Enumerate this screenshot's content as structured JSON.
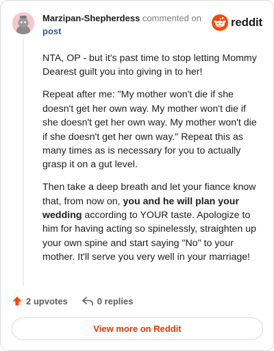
{
  "comment": {
    "author": "Marzipan-Shepherdess",
    "action_text": "commented on",
    "post_link": "post"
  },
  "brand": {
    "name": "reddit",
    "icon": "reddit-logo-icon",
    "color": "#ff4500"
  },
  "body": {
    "p1": "NTA, OP - but it's past time to stop letting Mommy Dearest guilt you into giving in to her!",
    "p2": "Repeat after me: \"My mother won't die if she doesn't get her own way. My mother won't die if she doesn't get her own way. My mother won't die if she doesn't get her own way.\" Repeat this as many times as is necessary for you to actually grasp it on a gut level.",
    "p3_before": "Then take a deep breath and let your fiance know that, from now on, ",
    "p3_bold": "you and he will plan your wedding",
    "p3_after": " according to YOUR taste. Apologize to him for having acting so spinelessly, straighten up your own spine and start saying \"No\" to your mother. It'll serve you very well in your marriage!"
  },
  "footer": {
    "upvotes": "2 upvotes",
    "replies": "0 replies",
    "upvote_icon": "upvote-arrow-icon",
    "reply_icon": "reply-icon",
    "upvote_color": "#ff4500"
  },
  "view_button": {
    "label": "View more on Reddit",
    "color": "#d13b00"
  }
}
